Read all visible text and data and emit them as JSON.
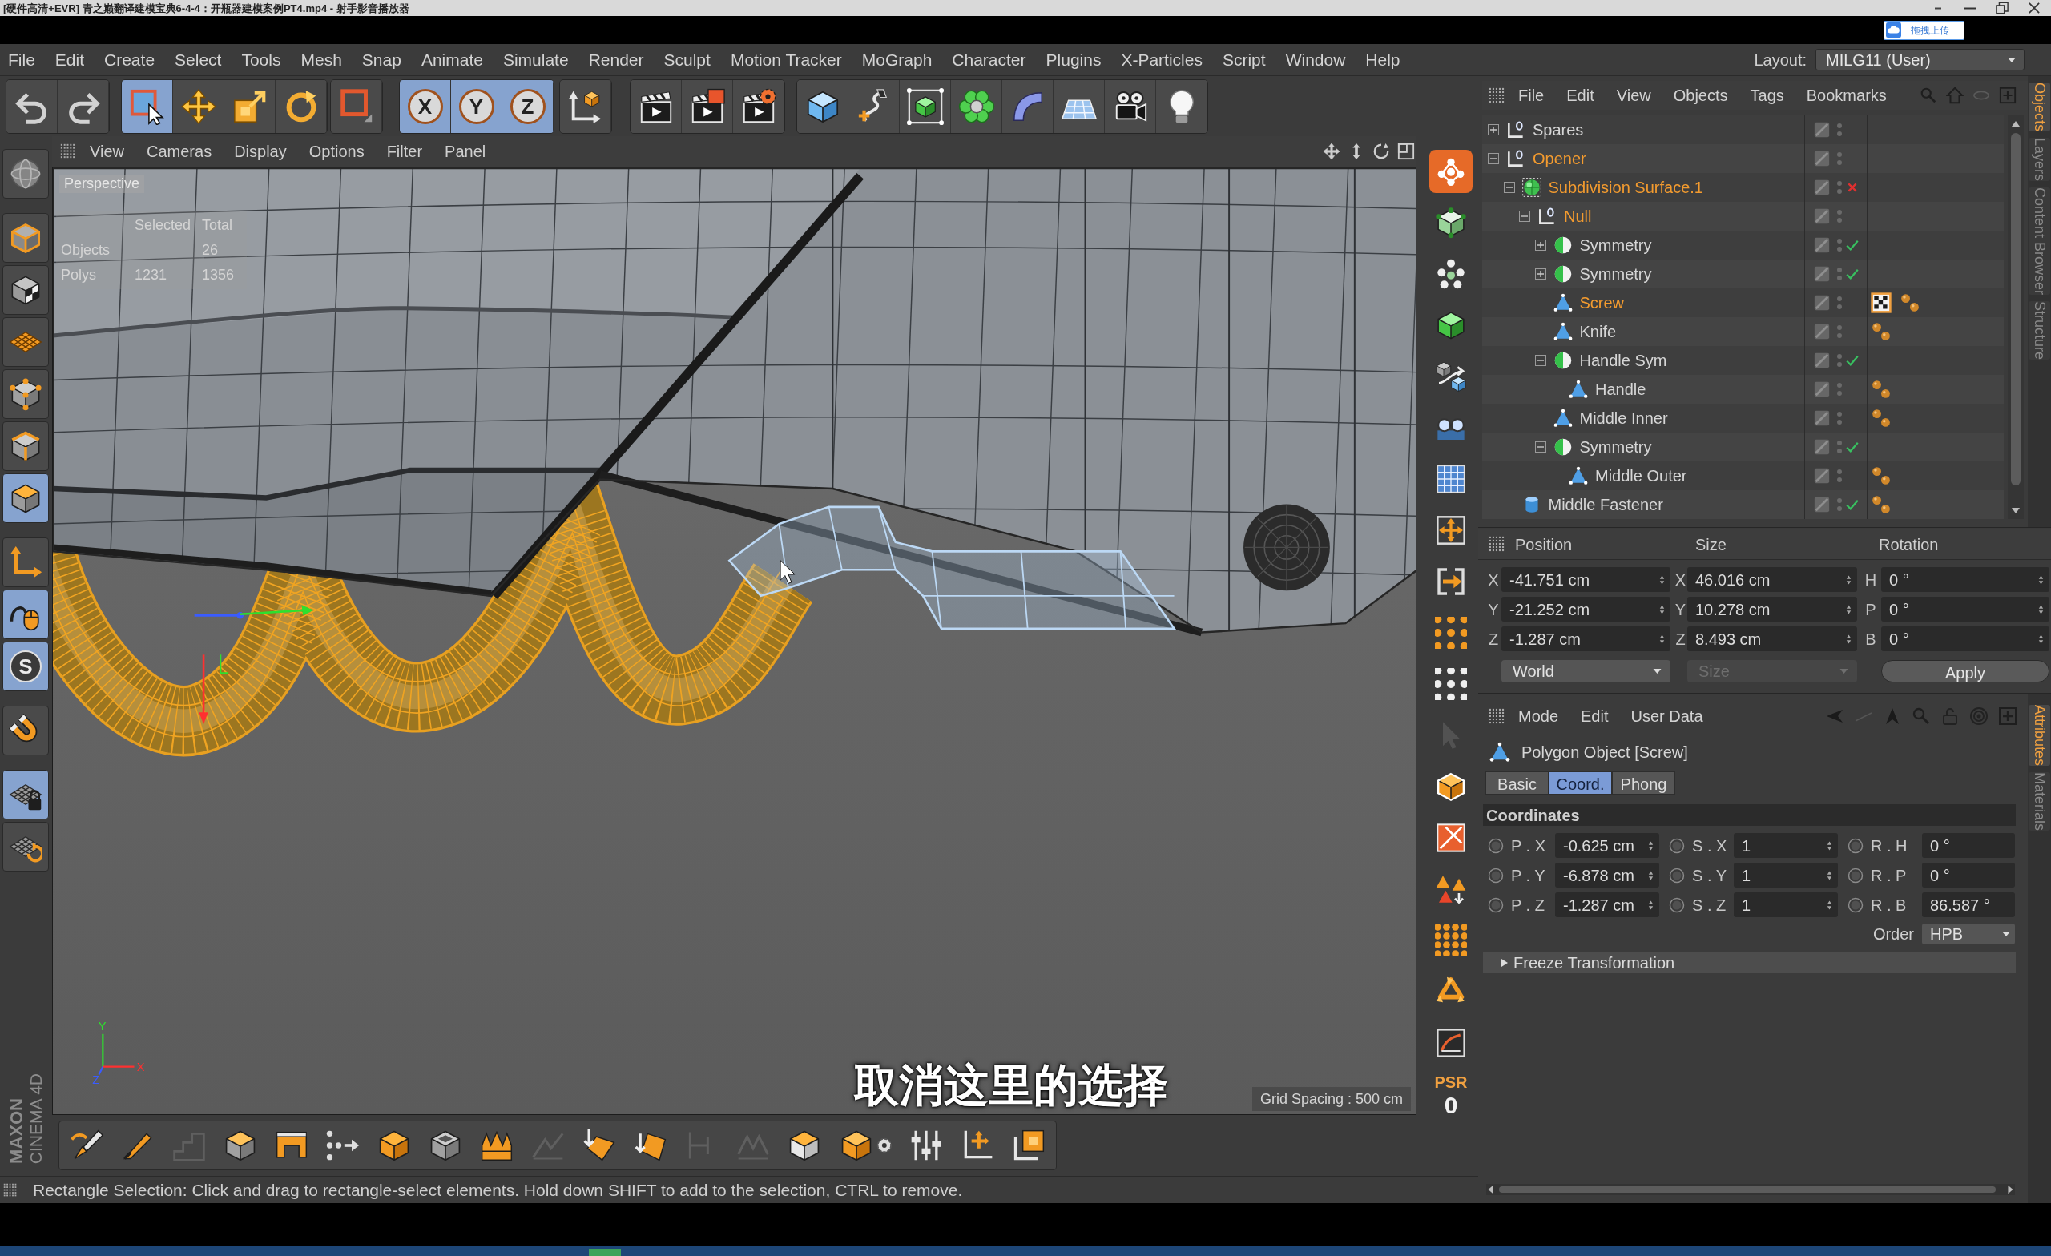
{
  "player": {
    "title": "[硬件高清+EVR] 青之巅翻译建模宝典6-4-4：开瓶器建模案例PT4.mp4 - 射手影音播放器",
    "upload_button": "拖拽上传"
  },
  "menu_bar": {
    "items": [
      "File",
      "Edit",
      "Create",
      "Select",
      "Tools",
      "Mesh",
      "Snap",
      "Animate",
      "Simulate",
      "Render",
      "Sculpt",
      "Motion Tracker",
      "MoGraph",
      "Character",
      "Plugins",
      "X-Particles",
      "Script",
      "Window",
      "Help"
    ],
    "layout_label": "Layout:",
    "layout_value": "MILG11 (User)"
  },
  "main_toolbar": [
    {
      "selected": false
    },
    {
      "selected": false
    },
    {
      "selected": true
    },
    {
      "selected": false
    },
    {
      "selected": false
    },
    {
      "selected": false
    },
    {
      "selected": false
    },
    {
      "selected": true,
      "label": "X"
    },
    {
      "selected": true,
      "label": "Y"
    },
    {
      "selected": true,
      "label": "Z"
    },
    {
      "selected": false
    },
    {
      "selected": false
    },
    {
      "selected": false
    },
    {
      "selected": false
    },
    {
      "selected": false
    },
    {
      "selected": false
    },
    {
      "selected": false
    },
    {
      "selected": false
    },
    {
      "selected": false
    },
    {
      "selected": false
    },
    {
      "selected": false
    },
    {
      "selected": false
    }
  ],
  "left_toolbar": [
    {
      "selected": false
    },
    {
      "selected": false
    },
    {
      "selected": false
    },
    {
      "selected": false
    },
    {
      "selected": false
    },
    {
      "selected": false
    },
    {
      "selected": true
    },
    {
      "selected": false
    },
    {
      "selected": true
    },
    {
      "selected": true,
      "label": "S"
    },
    {
      "selected": false
    },
    {
      "selected": true
    },
    {
      "selected": false
    }
  ],
  "brand": [
    "MAXON",
    "CINEMA 4D"
  ],
  "viewport": {
    "menu": [
      "View",
      "Cameras",
      "Display",
      "Options",
      "Filter",
      "Panel"
    ],
    "camera": "Perspective",
    "hud": {
      "columns": [
        "Selected",
        "Total"
      ],
      "rows": [
        {
          "label": "Objects",
          "total_value": "26"
        },
        {
          "label": "Polys",
          "selected_value": "1231",
          "total_value": "1356"
        }
      ]
    },
    "axis_letters": [
      "Y",
      "X",
      "Z"
    ],
    "grid_spacing": "Grid Spacing : 500 cm",
    "subtitle": "取消这里的选择"
  },
  "bottom_toolbar": [
    {
      "disabled": false
    },
    {
      "disabled": false
    },
    {
      "disabled": true
    },
    {
      "disabled": false
    },
    {
      "disabled": false
    },
    {
      "disabled": false
    },
    {
      "disabled": false
    },
    {
      "disabled": false
    },
    {
      "disabled": false
    },
    {
      "disabled": true
    },
    {
      "disabled": false
    },
    {
      "disabled": false
    },
    {
      "disabled": true
    },
    {
      "disabled": true
    },
    {
      "disabled": false
    },
    {
      "disabled": false
    },
    {
      "disabled": false
    },
    {
      "disabled": false
    },
    {
      "disabled": false
    }
  ],
  "right_toolbar": {
    "tools": [
      {
        "selected": true,
        "disabled": false
      },
      {
        "selected": false,
        "disabled": false
      },
      {
        "selected": false,
        "disabled": false
      },
      {
        "selected": false,
        "disabled": false
      },
      {
        "selected": false,
        "disabled": false
      },
      {
        "selected": false,
        "disabled": false
      },
      {
        "selected": false,
        "disabled": false
      },
      {
        "selected": false,
        "disabled": false
      },
      {
        "selected": false,
        "disabled": false
      },
      {
        "selected": false,
        "disabled": false
      },
      {
        "selected": false,
        "disabled": false
      },
      {
        "selected": false,
        "disabled": true
      },
      {
        "selected": false,
        "disabled": false
      },
      {
        "selected": false,
        "disabled": false
      },
      {
        "selected": false,
        "disabled": false
      },
      {
        "selected": false,
        "disabled": false
      },
      {
        "selected": false,
        "disabled": false
      },
      {
        "selected": false,
        "disabled": false
      }
    ],
    "psr_label": "PSR",
    "psr_value": "0"
  },
  "status_bar": "Rectangle Selection: Click and drag to rectangle-select elements. Hold down SHIFT to add to the selection, CTRL to remove.",
  "object_manager": {
    "menu": [
      "File",
      "Edit",
      "View",
      "Objects",
      "Tags",
      "Bookmarks"
    ],
    "objects": [
      {
        "name": "Spares",
        "kind": "null",
        "selected": false,
        "expanded": false
      },
      {
        "name": "Opener",
        "kind": "null",
        "selected": true,
        "expanded": true,
        "children": [
          {
            "name": "Subdivision Surface.1",
            "kind": "subdivision",
            "selected": true,
            "expanded": true,
            "enabled": false,
            "children": [
              {
                "name": "Null",
                "kind": "null",
                "selected": true,
                "expanded": true,
                "children": [
                  {
                    "name": "Symmetry",
                    "kind": "symmetry",
                    "selected": false,
                    "expanded": false,
                    "enabled": true
                  },
                  {
                    "name": "Symmetry",
                    "kind": "symmetry",
                    "selected": false,
                    "expanded": false,
                    "enabled": true
                  },
                  {
                    "name": "Screw",
                    "kind": "polygon",
                    "selected": true,
                    "tags": [
                      {
                        "kind": "texture",
                        "selected": true
                      },
                      {
                        "kind": "phong",
                        "selected": false
                      }
                    ]
                  },
                  {
                    "name": "Knife",
                    "kind": "polygon",
                    "selected": false,
                    "tags": [
                      {
                        "kind": "phong",
                        "selected": false
                      }
                    ]
                  },
                  {
                    "name": "Handle Sym",
                    "kind": "symmetry",
                    "selected": false,
                    "expanded": true,
                    "enabled": true,
                    "children": [
                      {
                        "name": "Handle",
                        "kind": "polygon",
                        "selected": false,
                        "tags": [
                          {
                            "kind": "phong",
                            "selected": false
                          }
                        ]
                      }
                    ]
                  },
                  {
                    "name": "Middle Inner",
                    "kind": "polygon",
                    "selected": false,
                    "tags": [
                      {
                        "kind": "phong",
                        "selected": false
                      }
                    ]
                  },
                  {
                    "name": "Symmetry",
                    "kind": "symmetry",
                    "selected": false,
                    "expanded": true,
                    "enabled": true,
                    "children": [
                      {
                        "name": "Middle Outer",
                        "kind": "polygon",
                        "selected": false,
                        "tags": [
                          {
                            "kind": "phong",
                            "selected": false
                          }
                        ]
                      }
                    ]
                  }
                ]
              }
            ]
          },
          {
            "name": "Middle Fastener",
            "kind": "cylinder",
            "selected": false,
            "enabled": true,
            "tags": [
              {
                "kind": "phong",
                "selected": false
              }
            ]
          }
        ]
      }
    ]
  },
  "coordinates": {
    "headers": [
      "Position",
      "Size",
      "Rotation"
    ],
    "rows": [
      {
        "position_axis": "X",
        "position": "-41.751 cm",
        "size_axis": "X",
        "size": "46.016 cm",
        "rotation_axis": "H",
        "rotation": "0 °"
      },
      {
        "position_axis": "Y",
        "position": "-21.252 cm",
        "size_axis": "Y",
        "size": "10.278 cm",
        "rotation_axis": "P",
        "rotation": "0 °"
      },
      {
        "position_axis": "Z",
        "position": "-1.287 cm",
        "size_axis": "Z",
        "size": "8.493 cm",
        "rotation_axis": "B",
        "rotation": "0 °"
      }
    ],
    "space_dropdown": {
      "value": "World",
      "disabled": false
    },
    "size_dropdown": {
      "value": "Size",
      "disabled": true
    },
    "apply_button": "Apply"
  },
  "attributes": {
    "menu": [
      "Mode",
      "Edit",
      "User Data"
    ],
    "object_title": "Polygon Object [Screw]",
    "tabs": [
      {
        "label": "Basic",
        "selected": false
      },
      {
        "label": "Coord.",
        "selected": true
      },
      {
        "label": "Phong",
        "selected": false
      }
    ],
    "section": "Coordinates",
    "rows": [
      [
        {
          "label": "P . X",
          "value": "-0.625 cm"
        },
        {
          "label": "S . X",
          "value": "1"
        },
        {
          "label": "R . H",
          "value": "0 °"
        }
      ],
      [
        {
          "label": "P . Y",
          "value": "-6.878 cm"
        },
        {
          "label": "S . Y",
          "value": "1"
        },
        {
          "label": "R . P",
          "value": "0 °"
        }
      ],
      [
        {
          "label": "P . Z",
          "value": "-1.287 cm"
        },
        {
          "label": "S . Z",
          "value": "1"
        },
        {
          "label": "R . B",
          "value": "86.587 °"
        }
      ]
    ],
    "order_label": "Order",
    "order_value": "HPB",
    "freeze": {
      "label": "Freeze Transformation",
      "expanded": false
    }
  },
  "side_tabs": {
    "upper": [
      {
        "label": "Objects",
        "selected": true
      },
      {
        "label": "Layers",
        "selected": false
      },
      {
        "label": "Content Browser",
        "selected": false
      },
      {
        "label": "Structure",
        "selected": false
      }
    ],
    "lower": [
      {
        "label": "Attributes",
        "selected": true
      },
      {
        "label": "Materials",
        "selected": false
      }
    ]
  }
}
